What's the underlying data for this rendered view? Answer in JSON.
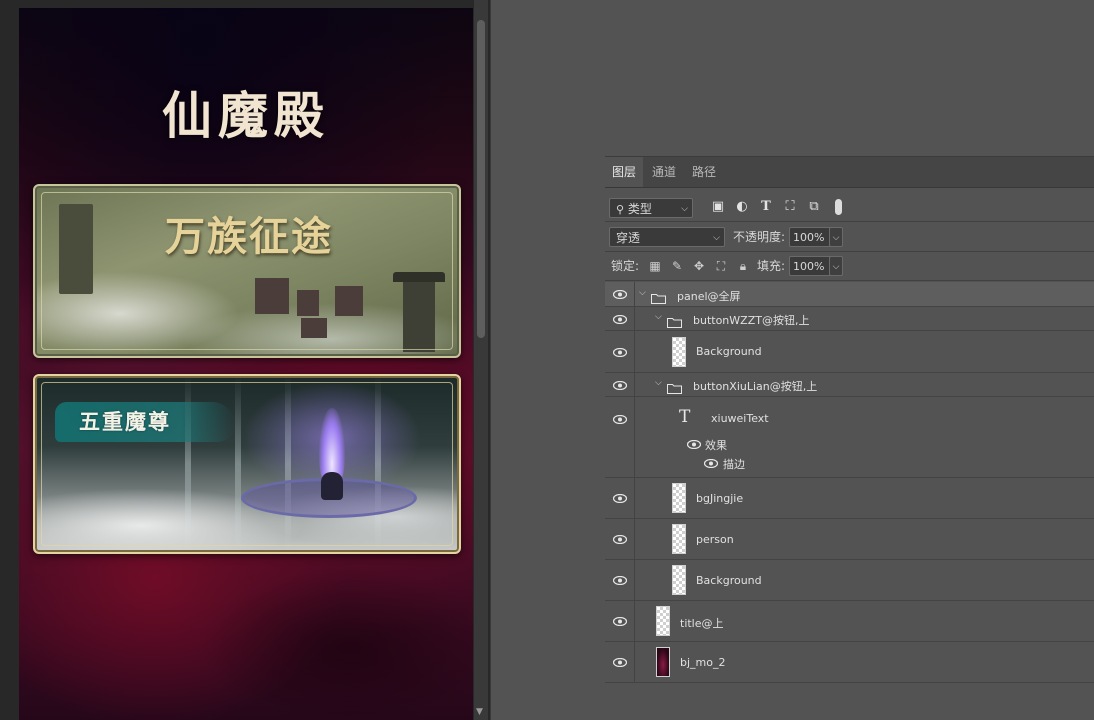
{
  "artboard": {
    "title": "仙魔殿",
    "card_wzzt_label": "万族征途",
    "card_xiulian_label": "五重魔尊"
  },
  "panel": {
    "tabs": [
      {
        "label": "图层",
        "active": true
      },
      {
        "label": "通道",
        "active": false
      },
      {
        "label": "路径",
        "active": false
      }
    ],
    "filter": {
      "search_icon": "search-icon",
      "kind_label": "类型",
      "filter_icons": [
        "image-filter-icon",
        "adjustment-filter-icon",
        "type-filter-icon",
        "shape-filter-icon",
        "smart-object-filter-icon",
        "filter-toggle-icon"
      ]
    },
    "blend": {
      "mode": "穿透",
      "opacity_label": "不透明度:",
      "opacity_value": "100%"
    },
    "lock": {
      "label": "锁定:",
      "icons": [
        "lock-transparent-icon",
        "lock-paint-icon",
        "lock-move-icon",
        "lock-artboard-icon",
        "lock-all-icon"
      ],
      "fill_label": "填充:",
      "fill_value": "100%"
    },
    "layers": [
      {
        "name": "panel@全屏",
        "kind": "group",
        "expanded": true,
        "selected": true
      },
      {
        "name": "buttonWZZT@按钮,上",
        "kind": "group",
        "expanded": true
      },
      {
        "name": "Background",
        "kind": "pixel"
      },
      {
        "name": "buttonXiuLian@按钮,上",
        "kind": "group",
        "expanded": true
      },
      {
        "name": "xiuweiText",
        "kind": "text",
        "effects_label": "效果",
        "effect_item": "描边"
      },
      {
        "name": "bgJingjie",
        "kind": "pixel"
      },
      {
        "name": "person",
        "kind": "pixel"
      },
      {
        "name": "Background",
        "kind": "pixel"
      },
      {
        "name": "title@上",
        "kind": "pixel"
      },
      {
        "name": "bj_mo_2",
        "kind": "pixel"
      }
    ]
  },
  "colors": {
    "panel_bg": "#535353",
    "selected_row": "#5e5e5e",
    "artboard_accent": "#52102a"
  }
}
